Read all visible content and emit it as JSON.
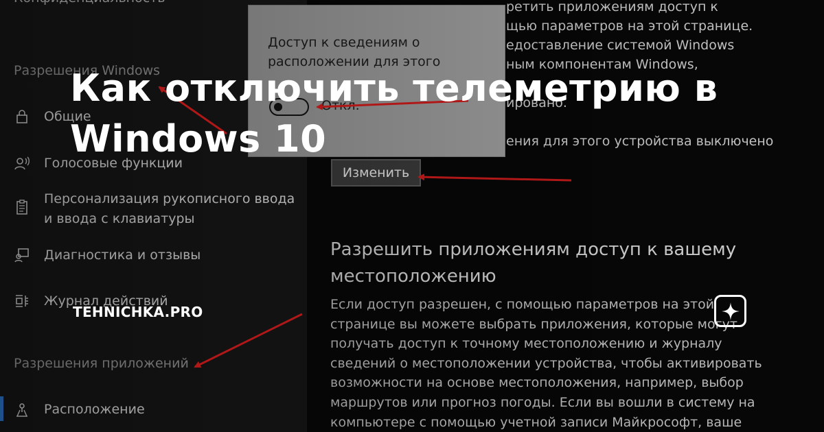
{
  "sidebar": {
    "top_label": "Конфиденциальность",
    "section_windows": "Разрешения Windows",
    "items": [
      {
        "label": "Общие",
        "icon": "lock-icon"
      },
      {
        "label": "Голосовые функции",
        "icon": "speech-icon"
      },
      {
        "label": "Персонализация рукописного ввода и ввода с клавиатуры",
        "icon": "clipboard-icon"
      },
      {
        "label": "Диагностика и отзывы",
        "icon": "feedback-icon"
      },
      {
        "label": "Журнал действий",
        "icon": "activity-history-icon"
      }
    ],
    "section_apps": "Разрешения приложений",
    "active_item": {
      "label": "Расположение",
      "icon": "location-icon"
    }
  },
  "main": {
    "intro_lines": [
      "ретить приложениям доступ к",
      "щью параметров на этой странице.",
      "едоставление системой Windows",
      "ным компонентам Windows,",
      "",
      "ировано."
    ],
    "status_text": "ения для этого устройства выключено",
    "change_button": "Изменить",
    "heading": "Разрешить приложениям доступ к вашему местоположению",
    "paragraph": "Если доступ разрешен, с помощью параметров на этой странице вы можете выбрать приложения, которые могут получать доступ к точному местоположению и журналу сведений о местоположении устройства, чтобы активировать возможности на основе местоположения, например, выбор маршрутов или прогноз погоды. Если вы вошли в систему на компьютере с помощью учетной записи Майкрософт, ваше"
  },
  "popup": {
    "text": "Доступ к сведениям о расположении для этого",
    "toggle_label": "Откл.",
    "toggle_on": false
  },
  "overlay": {
    "title": "Как отключить телеметрию в Windows 10",
    "brand": "TEHNICHKA.PRO",
    "brand_icon": "sparkle-icon"
  },
  "colors": {
    "sidebar_bg": "#171717",
    "main_bg": "#070707",
    "accent": "#2e7bd6",
    "arrow": "#b01818"
  }
}
